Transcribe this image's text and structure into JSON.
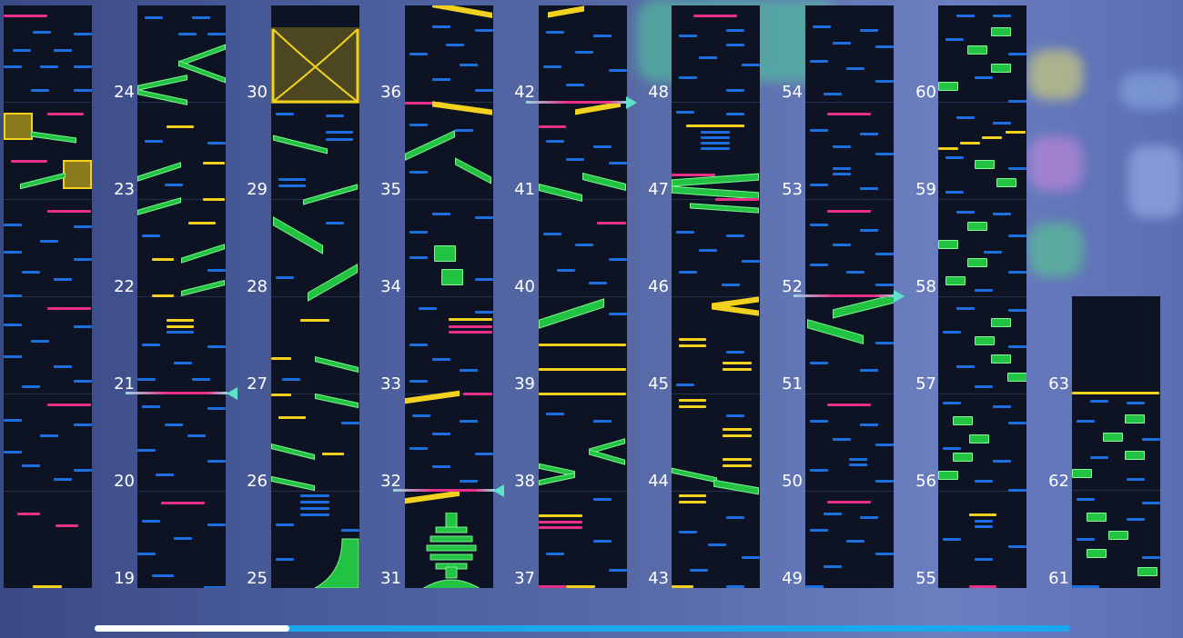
{
  "app": {
    "screen": "chart-overview"
  },
  "measures": {
    "col0": [
      "24",
      "23",
      "22",
      "21",
      "20",
      "19"
    ],
    "col1": [
      "30",
      "29",
      "28",
      "27",
      "26",
      "25"
    ],
    "col2": [
      "36",
      "35",
      "34",
      "33",
      "32",
      "31"
    ],
    "col3": [
      "42",
      "41",
      "40",
      "39",
      "38",
      "37"
    ],
    "col4": [
      "48",
      "47",
      "46",
      "45",
      "44",
      "43"
    ],
    "col5": [
      "54",
      "53",
      "52",
      "51",
      "50",
      "49"
    ],
    "col6": [
      "60",
      "59",
      "58",
      "57",
      "56",
      "55"
    ],
    "col7": [
      "63",
      "62",
      "61"
    ]
  },
  "colors": {
    "tap": "#1d6fe0",
    "flick": "#e8308a",
    "hold": "#f2d21e",
    "slide": "#22c342",
    "lane_bg": "#0d1322",
    "scrollbar": "#1aa7ee"
  },
  "scroll": {
    "progress": 0.2
  }
}
